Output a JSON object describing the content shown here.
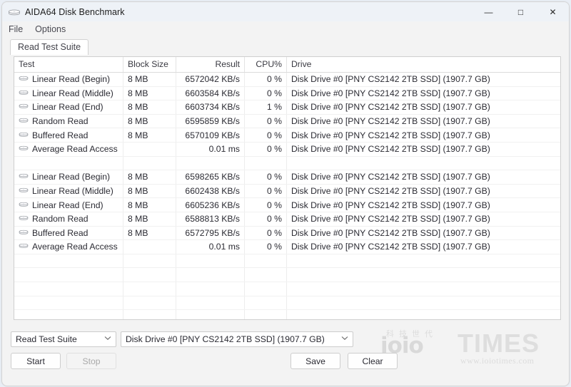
{
  "window": {
    "title": "AIDA64 Disk Benchmark",
    "icon": "disk-drive-icon",
    "controls": {
      "minimize": "—",
      "maximize": "□",
      "close": "✕"
    }
  },
  "menubar": {
    "items": [
      "File",
      "Options"
    ]
  },
  "tabs": [
    {
      "label": "Read Test Suite",
      "active": true
    }
  ],
  "table": {
    "columns": [
      "Test",
      "Block Size",
      "Result",
      "CPU%",
      "Drive",
      ""
    ],
    "rows": [
      {
        "test": "Linear Read (Begin)",
        "block": "8 MB",
        "result": "6572042 KB/s",
        "cpu": "0 %",
        "drive": "Disk Drive #0  [PNY CS2142 2TB SSD]  (1907.7 GB)",
        "icon": "disk-drive-icon"
      },
      {
        "test": "Linear Read (Middle)",
        "block": "8 MB",
        "result": "6603584 KB/s",
        "cpu": "0 %",
        "drive": "Disk Drive #0  [PNY CS2142 2TB SSD]  (1907.7 GB)",
        "icon": "disk-drive-icon"
      },
      {
        "test": "Linear Read (End)",
        "block": "8 MB",
        "result": "6603734 KB/s",
        "cpu": "1 %",
        "drive": "Disk Drive #0  [PNY CS2142 2TB SSD]  (1907.7 GB)",
        "icon": "disk-drive-icon"
      },
      {
        "test": "Random Read",
        "block": "8 MB",
        "result": "6595859 KB/s",
        "cpu": "0 %",
        "drive": "Disk Drive #0  [PNY CS2142 2TB SSD]  (1907.7 GB)",
        "icon": "disk-drive-icon"
      },
      {
        "test": "Buffered Read",
        "block": "8 MB",
        "result": "6570109 KB/s",
        "cpu": "0 %",
        "drive": "Disk Drive #0  [PNY CS2142 2TB SSD]  (1907.7 GB)",
        "icon": "disk-drive-icon"
      },
      {
        "test": "Average Read Access",
        "block": "",
        "result": "0.01 ms",
        "cpu": "0 %",
        "drive": "Disk Drive #0  [PNY CS2142 2TB SSD]  (1907.7 GB)",
        "icon": "disk-drive-icon"
      },
      {
        "test": "",
        "block": "",
        "result": "",
        "cpu": "",
        "drive": "",
        "icon": ""
      },
      {
        "test": "Linear Read (Begin)",
        "block": "8 MB",
        "result": "6598265 KB/s",
        "cpu": "0 %",
        "drive": "Disk Drive #0  [PNY CS2142 2TB SSD]  (1907.7 GB)",
        "icon": "disk-drive-icon"
      },
      {
        "test": "Linear Read (Middle)",
        "block": "8 MB",
        "result": "6602438 KB/s",
        "cpu": "0 %",
        "drive": "Disk Drive #0  [PNY CS2142 2TB SSD]  (1907.7 GB)",
        "icon": "disk-drive-icon"
      },
      {
        "test": "Linear Read (End)",
        "block": "8 MB",
        "result": "6605236 KB/s",
        "cpu": "0 %",
        "drive": "Disk Drive #0  [PNY CS2142 2TB SSD]  (1907.7 GB)",
        "icon": "disk-drive-icon"
      },
      {
        "test": "Random Read",
        "block": "8 MB",
        "result": "6588813 KB/s",
        "cpu": "0 %",
        "drive": "Disk Drive #0  [PNY CS2142 2TB SSD]  (1907.7 GB)",
        "icon": "disk-drive-icon"
      },
      {
        "test": "Buffered Read",
        "block": "8 MB",
        "result": "6572795 KB/s",
        "cpu": "0 %",
        "drive": "Disk Drive #0  [PNY CS2142 2TB SSD]  (1907.7 GB)",
        "icon": "disk-drive-icon"
      },
      {
        "test": "Average Read Access",
        "block": "",
        "result": "0.01 ms",
        "cpu": "0 %",
        "drive": "Disk Drive #0  [PNY CS2142 2TB SSD]  (1907.7 GB)",
        "icon": "disk-drive-icon"
      }
    ],
    "blank_rows": 6
  },
  "controls": {
    "suite_combo": {
      "value": "Read Test Suite",
      "chevron": "⌄"
    },
    "drive_combo": {
      "value": "Disk Drive #0  [PNY CS2142 2TB SSD]  (1907.7 GB)",
      "chevron": "⌄"
    },
    "start_button": "Start",
    "stop_button": "Stop",
    "stop_disabled": true,
    "save_button": "Save",
    "clear_button": "Clear"
  },
  "watermark": {
    "cjk": "科技世代",
    "brand": "ioio",
    "brand2": "TIMES",
    "url": "www.ioiotimes.com"
  },
  "colors": {
    "window_bg": "#f3f3f3",
    "titlebar_bg": "#eef2f7",
    "table_bg": "#ffffff",
    "border": "#cfcfcf",
    "text": "#2b2b33",
    "watermark": "#dcdcdc"
  }
}
